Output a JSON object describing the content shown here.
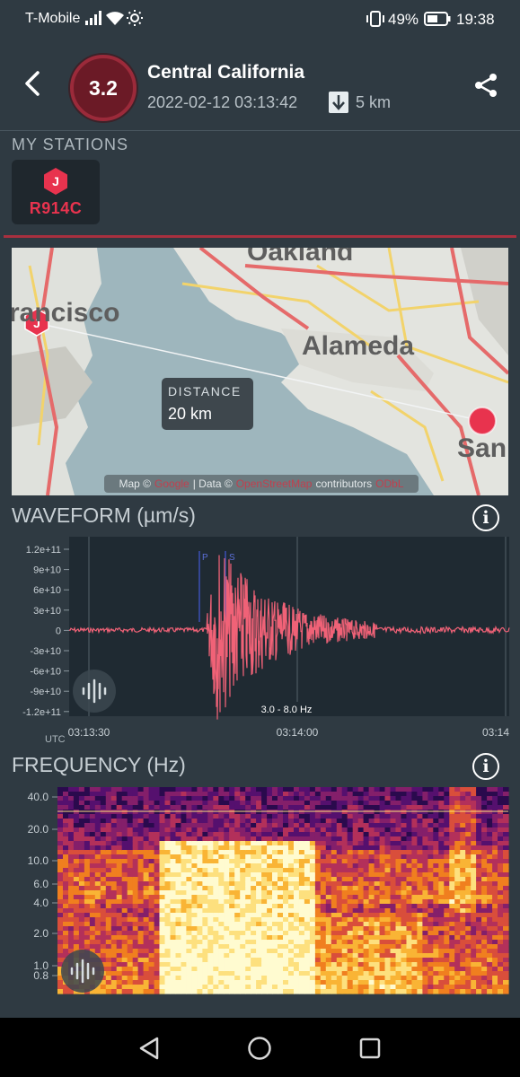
{
  "status_bar": {
    "carrier": "T-Mobile",
    "battery": "49%",
    "time": "19:38",
    "icons": [
      "signal-icon",
      "wifi-icon",
      "sun-icon",
      "vibrate-icon",
      "battery-icon"
    ]
  },
  "header": {
    "magnitude": "3.2",
    "title": "Central California",
    "datetime": "2022-02-12 03:13:42",
    "depth": "5 km",
    "colors": {
      "magnitude_ring": "#9b2a3a",
      "accent": "#e8334e"
    }
  },
  "stations": {
    "label": "MY STATIONS",
    "items": [
      {
        "badge": "J",
        "name": "R914C"
      }
    ]
  },
  "map": {
    "place_labels": [
      "Oakland",
      "rancisco",
      "Alameda",
      "San"
    ],
    "station_marker": "J",
    "distance_label": "DISTANCE",
    "distance_value": "20 km",
    "attribution": {
      "prefix": "Map ©",
      "link1": "Google",
      "middle": "| Data ©",
      "link2": "OpenStreetMap",
      "suffix": "contributors",
      "link3": "ODbL"
    }
  },
  "waveform": {
    "title": "WAVEFORM (µm/s)",
    "y_ticks": [
      "1.2e+11",
      "9e+10",
      "6e+10",
      "3e+10",
      "0",
      "-3e+10",
      "-6e+10",
      "-9e+10",
      "-1.2e+11"
    ],
    "x_ticks": [
      "03:13:30",
      "03:14:00",
      "03:14"
    ],
    "utc_label": "UTC",
    "filter_label": "3.0 - 8.0 Hz",
    "p_label": "P",
    "s_label": "S",
    "line_color": "#f06277"
  },
  "frequency": {
    "title": "FREQUENCY (Hz)",
    "y_ticks": [
      "40.0",
      "20.0",
      "10.0",
      "6.0",
      "4.0",
      "2.0",
      "1.0",
      "0.8"
    ]
  },
  "nav": {
    "icons": [
      "back-triangle-icon",
      "home-circle-icon",
      "recents-square-icon"
    ]
  }
}
